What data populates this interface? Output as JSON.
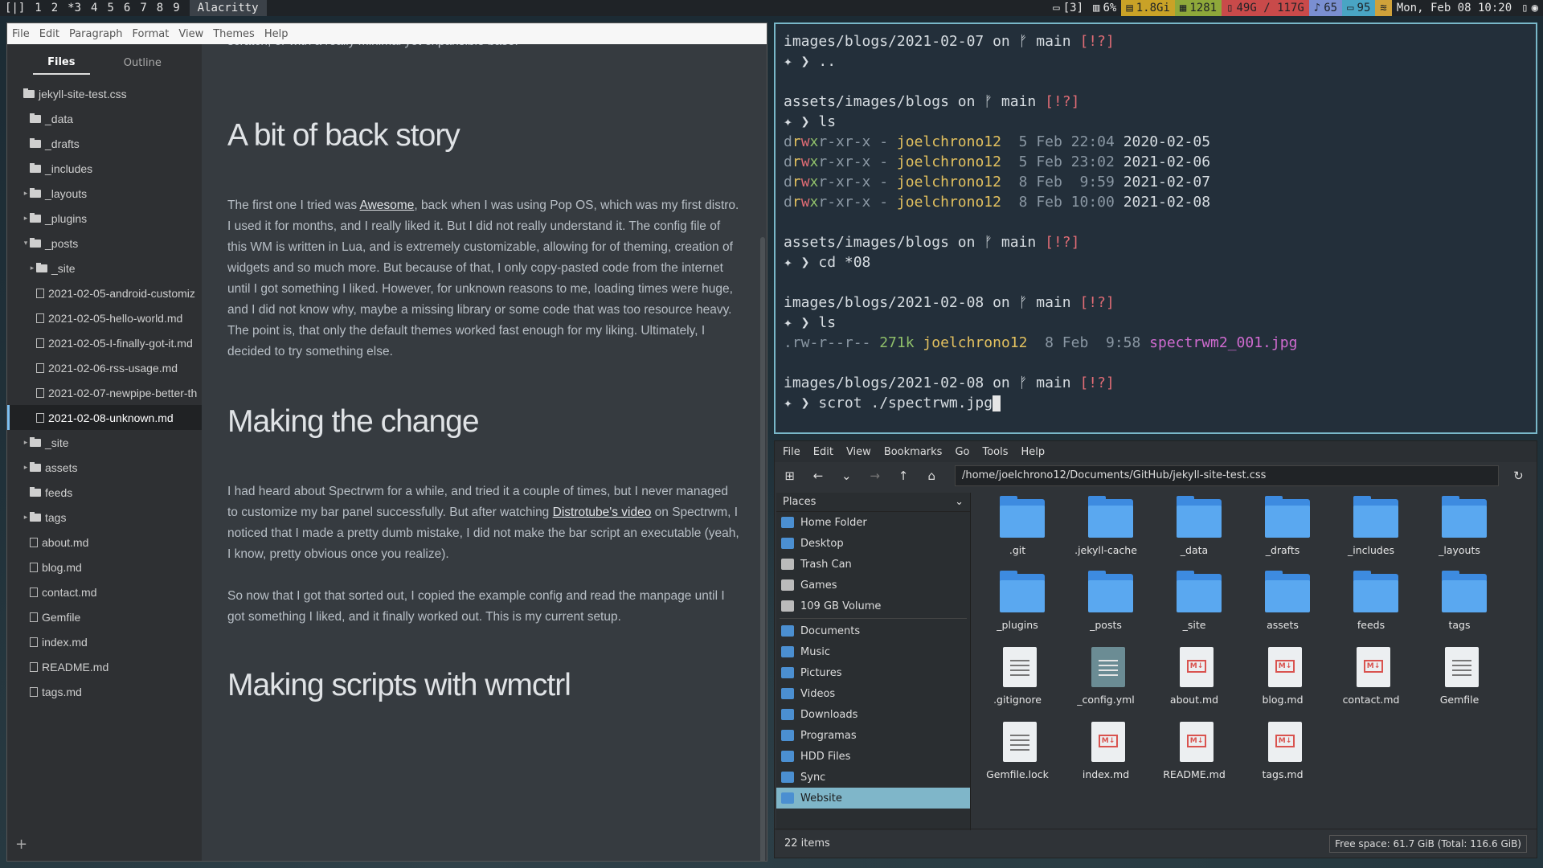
{
  "topbar": {
    "layout": "[|]",
    "workspaces": [
      "1",
      "2",
      "*3",
      "4",
      "5",
      "6",
      "7",
      "8",
      "9"
    ],
    "window_name": "Alacritty",
    "screen": "[3]",
    "cpu_pct": "6%",
    "mem": "1.8Gi",
    "procs": "1281",
    "disk": "49G / 117G",
    "volume": "65",
    "battery": "95",
    "clock": "Mon, Feb 08 10:20"
  },
  "typora": {
    "menu": [
      "File",
      "Edit",
      "Paragraph",
      "Format",
      "View",
      "Themes",
      "Help"
    ],
    "tabs": [
      "Files",
      "Outline"
    ],
    "tree": [
      {
        "label": "jekyll-site-test.css",
        "type": "folder",
        "depth": 0,
        "tri": ""
      },
      {
        "label": "_data",
        "type": "folder",
        "depth": 1,
        "tri": ""
      },
      {
        "label": "_drafts",
        "type": "folder",
        "depth": 1,
        "tri": ""
      },
      {
        "label": "_includes",
        "type": "folder",
        "depth": 1,
        "tri": ""
      },
      {
        "label": "_layouts",
        "type": "folder",
        "depth": 1,
        "tri": "▸"
      },
      {
        "label": "_plugins",
        "type": "folder",
        "depth": 1,
        "tri": "▸"
      },
      {
        "label": "_posts",
        "type": "folder",
        "depth": 1,
        "tri": "▾"
      },
      {
        "label": "_site",
        "type": "folder",
        "depth": 2,
        "tri": "▸"
      },
      {
        "label": "2021-02-05-android-customiz",
        "type": "file",
        "depth": 2,
        "tri": ""
      },
      {
        "label": "2021-02-05-hello-world.md",
        "type": "file",
        "depth": 2,
        "tri": ""
      },
      {
        "label": "2021-02-05-I-finally-got-it.md",
        "type": "file",
        "depth": 2,
        "tri": ""
      },
      {
        "label": "2021-02-06-rss-usage.md",
        "type": "file",
        "depth": 2,
        "tri": ""
      },
      {
        "label": "2021-02-07-newpipe-better-th",
        "type": "file",
        "depth": 2,
        "tri": ""
      },
      {
        "label": "2021-02-08-unknown.md",
        "type": "file",
        "depth": 2,
        "tri": "",
        "selected": true
      },
      {
        "label": "_site",
        "type": "folder",
        "depth": 1,
        "tri": "▸"
      },
      {
        "label": "assets",
        "type": "folder",
        "depth": 1,
        "tri": "▸"
      },
      {
        "label": "feeds",
        "type": "folder",
        "depth": 1,
        "tri": ""
      },
      {
        "label": "tags",
        "type": "folder",
        "depth": 1,
        "tri": "▸"
      },
      {
        "label": "about.md",
        "type": "file",
        "depth": 1,
        "tri": ""
      },
      {
        "label": "blog.md",
        "type": "file",
        "depth": 1,
        "tri": ""
      },
      {
        "label": "contact.md",
        "type": "file",
        "depth": 1,
        "tri": ""
      },
      {
        "label": "Gemfile",
        "type": "file",
        "depth": 1,
        "tri": ""
      },
      {
        "label": "index.md",
        "type": "file",
        "depth": 1,
        "tri": ""
      },
      {
        "label": "README.md",
        "type": "file",
        "depth": 1,
        "tri": ""
      },
      {
        "label": "tags.md",
        "type": "file",
        "depth": 1,
        "tri": ""
      }
    ],
    "add_label": "+",
    "doc": {
      "top_fragment": "scratch, or with a really minimal yet expansible base.",
      "h1": "A bit of back story",
      "p1_a": "The first one I tried was ",
      "p1_link": "Awesome",
      "p1_b": ", back when I was using Pop OS, which was my first distro. I used it for months, and I really liked it. But I did not really understand it. The config file of this WM is written in Lua, and is extremely customizable, allowing for of theming, creation of widgets and so much more. But because of that, I only copy-pasted code from the internet until I got something I liked. However, for unknown reasons to me, loading times were huge, and I did not know why, maybe a missing library or some code that was too resource heavy. The point is, that only the default themes worked fast enough for my liking. Ultimately, I decided to try something else.",
      "h2": "Making the change",
      "p2_a": "I had heard about Spectrwm for a while, and tried it a couple of times, but I never managed to customize my bar panel successfully. But after watching ",
      "p2_link": "Distrotube's video",
      "p2_b": " on Spectrwm, I noticed that I made a pretty dumb mistake, I did not make the bar script an executable (yeah, I know, pretty obvious once you realize).",
      "p3": "So now that I got that sorted out, I copied the example config and read the manpage until I got something I liked, and it finally worked out. This is my current setup.",
      "h3": "Making scripts with wmctrl"
    }
  },
  "terminal": {
    "lines": [
      [
        {
          "t": "images/blogs/2021-02-07",
          "c": ""
        },
        {
          "t": " on ",
          "c": ""
        },
        {
          "t": "ᚠ main ",
          "c": ""
        },
        {
          "t": "[!?]",
          "c": "c-red"
        }
      ],
      [
        {
          "t": "✦ ❯ ",
          "c": ""
        },
        {
          "t": "..",
          "c": ""
        }
      ],
      [
        {
          "t": "",
          "c": ""
        }
      ],
      [
        {
          "t": "assets/images/blogs",
          "c": ""
        },
        {
          "t": " on ",
          "c": ""
        },
        {
          "t": "ᚠ main ",
          "c": ""
        },
        {
          "t": "[!?]",
          "c": "c-red"
        }
      ],
      [
        {
          "t": "✦ ❯ ",
          "c": ""
        },
        {
          "t": "ls",
          "c": ""
        }
      ],
      [
        {
          "t": "d",
          "c": "c-dim"
        },
        {
          "t": "r",
          "c": "c-yel"
        },
        {
          "t": "w",
          "c": "c-red"
        },
        {
          "t": "x",
          "c": "c-grn"
        },
        {
          "t": "r-xr-x",
          "c": "c-dim"
        },
        {
          "t": " - ",
          "c": "c-dim"
        },
        {
          "t": "joelchrono12",
          "c": "c-yel"
        },
        {
          "t": "  5 Feb 22:04 ",
          "c": "c-dim"
        },
        {
          "t": "2020-02-05",
          "c": ""
        }
      ],
      [
        {
          "t": "d",
          "c": "c-dim"
        },
        {
          "t": "r",
          "c": "c-yel"
        },
        {
          "t": "w",
          "c": "c-red"
        },
        {
          "t": "x",
          "c": "c-grn"
        },
        {
          "t": "r-xr-x",
          "c": "c-dim"
        },
        {
          "t": " - ",
          "c": "c-dim"
        },
        {
          "t": "joelchrono12",
          "c": "c-yel"
        },
        {
          "t": "  5 Feb 23:02 ",
          "c": "c-dim"
        },
        {
          "t": "2021-02-06",
          "c": ""
        }
      ],
      [
        {
          "t": "d",
          "c": "c-dim"
        },
        {
          "t": "r",
          "c": "c-yel"
        },
        {
          "t": "w",
          "c": "c-red"
        },
        {
          "t": "x",
          "c": "c-grn"
        },
        {
          "t": "r-xr-x",
          "c": "c-dim"
        },
        {
          "t": " - ",
          "c": "c-dim"
        },
        {
          "t": "joelchrono12",
          "c": "c-yel"
        },
        {
          "t": "  8 Feb  9:59 ",
          "c": "c-dim"
        },
        {
          "t": "2021-02-07",
          "c": ""
        }
      ],
      [
        {
          "t": "d",
          "c": "c-dim"
        },
        {
          "t": "r",
          "c": "c-yel"
        },
        {
          "t": "w",
          "c": "c-red"
        },
        {
          "t": "x",
          "c": "c-grn"
        },
        {
          "t": "r-xr-x",
          "c": "c-dim"
        },
        {
          "t": " - ",
          "c": "c-dim"
        },
        {
          "t": "joelchrono12",
          "c": "c-yel"
        },
        {
          "t": "  8 Feb 10:00 ",
          "c": "c-dim"
        },
        {
          "t": "2021-02-08",
          "c": ""
        }
      ],
      [
        {
          "t": "",
          "c": ""
        }
      ],
      [
        {
          "t": "assets/images/blogs",
          "c": ""
        },
        {
          "t": " on ",
          "c": ""
        },
        {
          "t": "ᚠ main ",
          "c": ""
        },
        {
          "t": "[!?]",
          "c": "c-red"
        }
      ],
      [
        {
          "t": "✦ ❯ ",
          "c": ""
        },
        {
          "t": "cd *08",
          "c": ""
        }
      ],
      [
        {
          "t": "",
          "c": ""
        }
      ],
      [
        {
          "t": "images/blogs/2021-02-08",
          "c": ""
        },
        {
          "t": " on ",
          "c": ""
        },
        {
          "t": "ᚠ main ",
          "c": ""
        },
        {
          "t": "[!?]",
          "c": "c-red"
        }
      ],
      [
        {
          "t": "✦ ❯ ",
          "c": ""
        },
        {
          "t": "ls",
          "c": ""
        }
      ],
      [
        {
          "t": ".rw-r--r--",
          "c": "c-dim"
        },
        {
          "t": " 271k ",
          "c": "c-grn"
        },
        {
          "t": "joelchrono12",
          "c": "c-yel"
        },
        {
          "t": "  8 Feb  9:58 ",
          "c": "c-dim"
        },
        {
          "t": "spectrwm2_001.jpg",
          "c": "c-pink"
        }
      ],
      [
        {
          "t": "",
          "c": ""
        }
      ],
      [
        {
          "t": "images/blogs/2021-02-08",
          "c": ""
        },
        {
          "t": " on ",
          "c": ""
        },
        {
          "t": "ᚠ main ",
          "c": ""
        },
        {
          "t": "[!?]",
          "c": "c-red"
        }
      ],
      [
        {
          "t": "✦ ❯ ",
          "c": ""
        },
        {
          "t": "scrot ./spectrwm.jpg",
          "c": ""
        }
      ]
    ]
  },
  "filemanager": {
    "menu": [
      "File",
      "Edit",
      "View",
      "Bookmarks",
      "Go",
      "Tools",
      "Help"
    ],
    "path": "/home/joelchrono12/Documents/GitHub/jekyll-site-test.css",
    "places_header": "Places",
    "places": [
      "Home Folder",
      "Desktop",
      "Trash Can",
      "Games",
      "109 GB Volume",
      "Documents",
      "Music",
      "Pictures",
      "Videos",
      "Downloads",
      "Programas",
      "HDD Files",
      "Sync",
      "Website"
    ],
    "selected_place": "Website",
    "items": [
      {
        "name": ".git",
        "kind": "folder"
      },
      {
        "name": ".jekyll-cache",
        "kind": "folder"
      },
      {
        "name": "_data",
        "kind": "folder"
      },
      {
        "name": "_drafts",
        "kind": "folder"
      },
      {
        "name": "_includes",
        "kind": "folder"
      },
      {
        "name": "_layouts",
        "kind": "folder"
      },
      {
        "name": "_plugins",
        "kind": "folder"
      },
      {
        "name": "_posts",
        "kind": "folder"
      },
      {
        "name": "_site",
        "kind": "folder"
      },
      {
        "name": "assets",
        "kind": "folder"
      },
      {
        "name": "feeds",
        "kind": "folder"
      },
      {
        "name": "tags",
        "kind": "folder"
      },
      {
        "name": ".gitignore",
        "kind": "text"
      },
      {
        "name": "_config.yml",
        "kind": "config"
      },
      {
        "name": "about.md",
        "kind": "md"
      },
      {
        "name": "blog.md",
        "kind": "md"
      },
      {
        "name": "contact.md",
        "kind": "md"
      },
      {
        "name": "Gemfile",
        "kind": "text"
      },
      {
        "name": "Gemfile.lock",
        "kind": "text"
      },
      {
        "name": "index.md",
        "kind": "md"
      },
      {
        "name": "README.md",
        "kind": "md"
      },
      {
        "name": "tags.md",
        "kind": "md"
      }
    ],
    "status_items": "22 items",
    "free_space": "Free space: 61.7 GiB (Total: 116.6 GiB)"
  }
}
